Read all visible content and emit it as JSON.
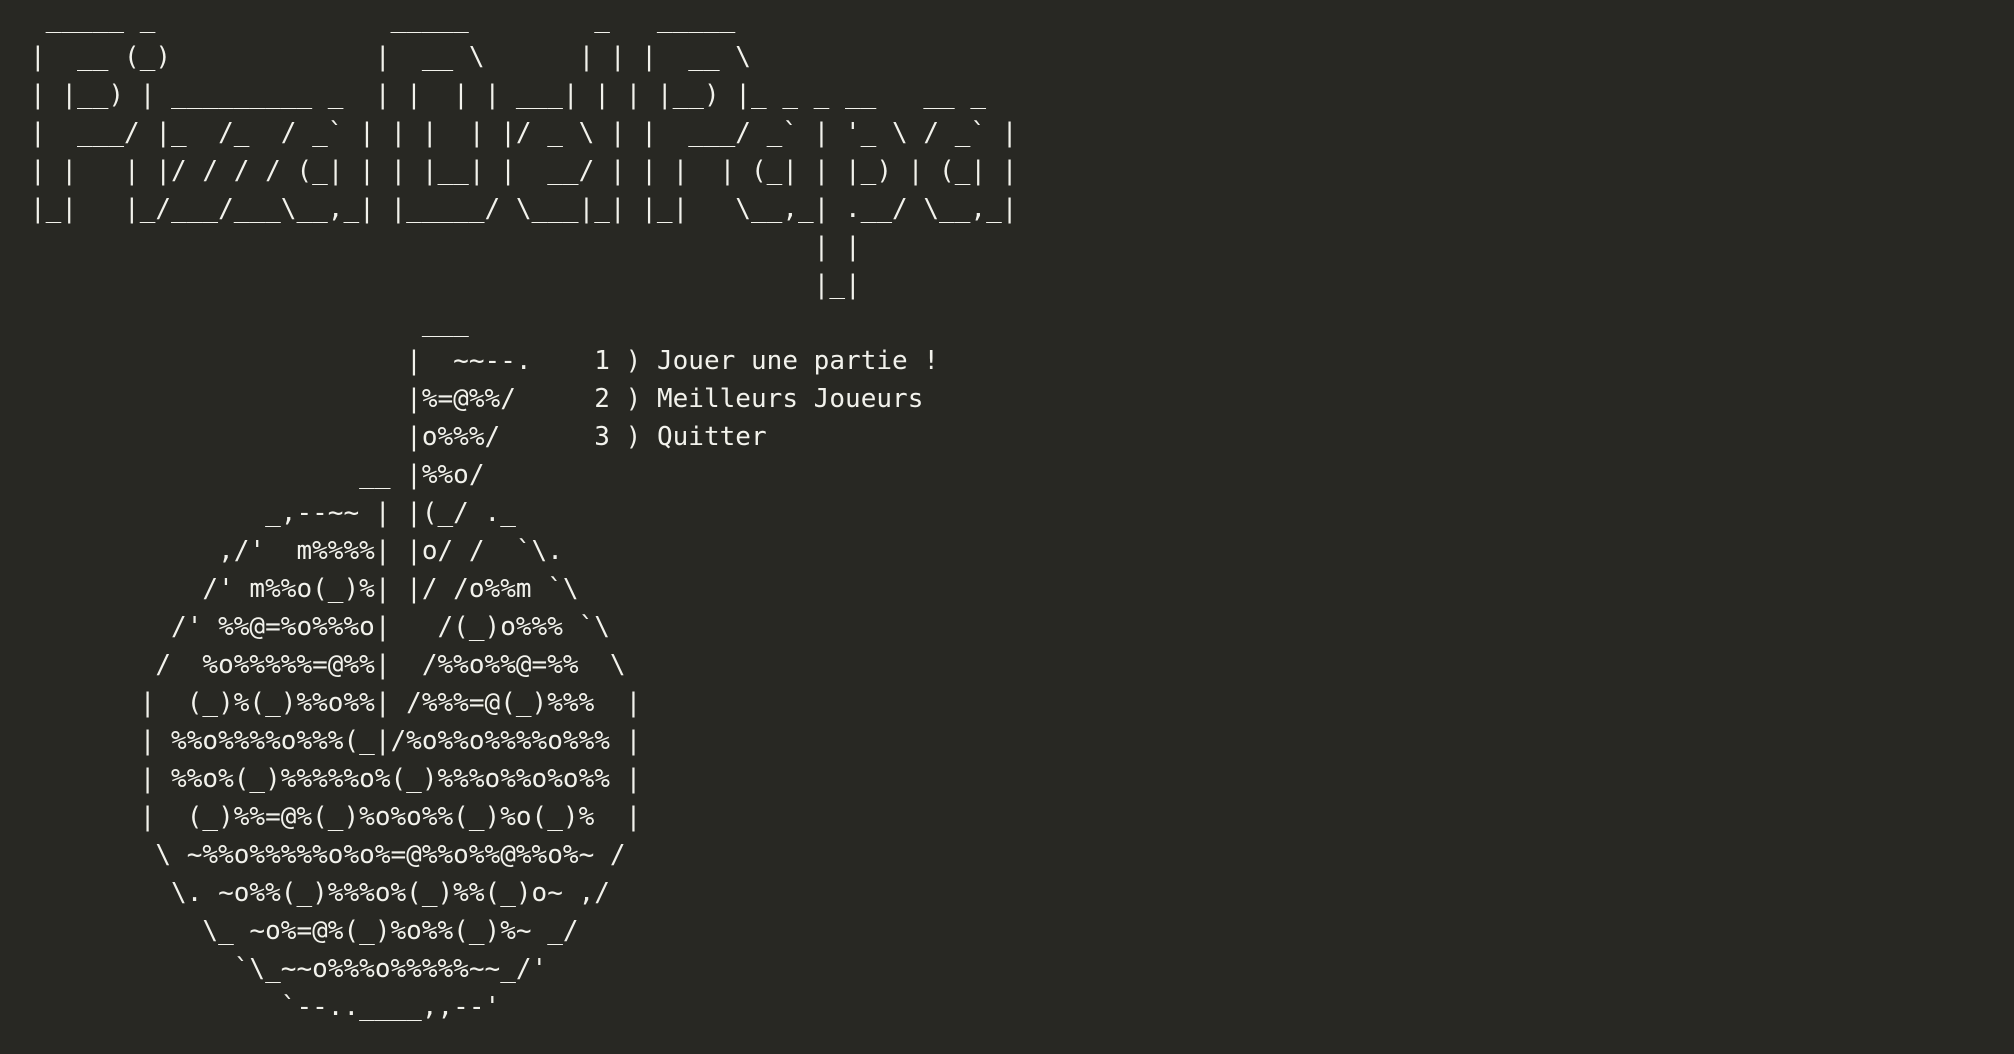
{
  "terminal": {
    "background": "#282823",
    "foreground": "#f2f2ec"
  },
  "banner": [
    " _____ _               _____        _   _____",
    "|  __ (_)             |  __ \\      | | |  __ \\",
    "| |__) | _________ _  | |  | | ___| | | |__) |_ _ _ __   __ _",
    "|  ___/ |_  /_  / _` | | |  | |/ _ \\ | |  ___/ _` | '_ \\ / _` |",
    "| |   | |/ / / / (_| | | |__| |  __/ | | |  | (_| | |_) | (_| |",
    "|_|   |_/___/___\\__,_| |_____/ \\___|_| |_|   \\__,_| .__/ \\__,_|",
    "                                                  | |",
    "                                                  |_|"
  ],
  "pizza_art": [
    "                         ___",
    "                        |  ~~--.",
    "                        |%=@%%/",
    "                        |o%%%/",
    "                     __ |%%o/",
    "               _,--~~ | |(_/ ._",
    "            ,/'  m%%%%| |o/ /  `\\.",
    "           /' m%%o(_)%| |/ /o%%m `\\",
    "         /' %%@=%o%%%o|   /(_)o%%% `\\",
    "        /  %o%%%%%=@%%|  /%%o%%@=%%  \\",
    "       |  (_)%(_)%%o%%| /%%%=@(_)%%%  |",
    "       | %%o%%%%o%%%(_|/%o%%o%%%%o%%% |",
    "       | %%o%(_)%%%%%o%(_)%%%o%%o%o%% |",
    "       |  (_)%%=@%(_)%o%o%%(_)%o(_)%  |",
    "        \\ ~%%o%%%%%o%o%=@%%o%%@%%o%~ /",
    "         \\. ~o%%(_)%%%o%(_)%%(_)o~ ,/",
    "           \\_ ~o%=@%(_)%o%%(_)%~ _/",
    "             `\\_~~o%%%o%%%%%~~_/'",
    "                `--..____,,--'"
  ],
  "menu": [
    {
      "prefix": "    ",
      "label": "1 ) Jouer une partie !"
    },
    {
      "prefix": "     ",
      "label": "2 ) Meilleurs Joueurs"
    },
    {
      "prefix": "      ",
      "label": "3 ) Quitter"
    }
  ]
}
